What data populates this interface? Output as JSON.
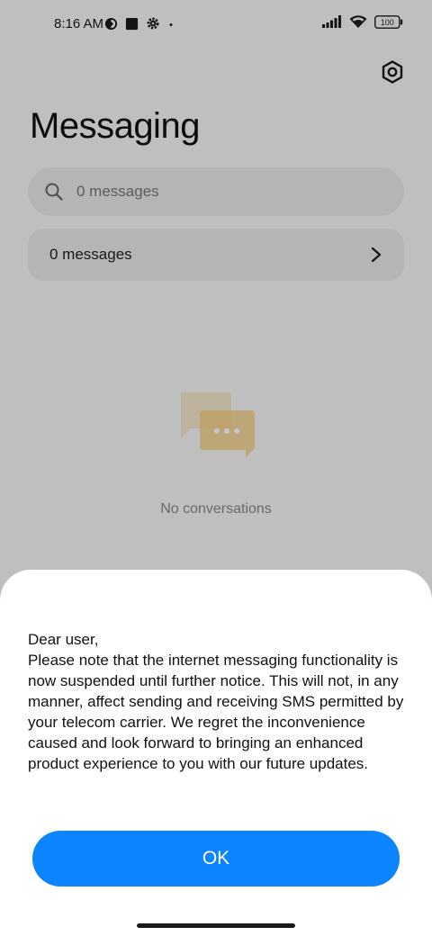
{
  "status_bar": {
    "time": "8:16 AM",
    "battery": "100"
  },
  "header": {
    "title": "Messaging"
  },
  "search": {
    "placeholder": "0 messages"
  },
  "messages_row": {
    "label": "0 messages"
  },
  "empty_state": {
    "text": "No conversations"
  },
  "dialog": {
    "greeting": "Dear user,",
    "body": "Please note that the internet messaging functionality is now suspended until further notice. This will not, in any manner, affect sending and receiving SMS permitted by your telecom carrier. We regret the inconvenience caused and look forward to bringing an enhanced product experience to you with our future updates.",
    "ok_label": "OK"
  },
  "colors": {
    "accent": "#0d84ff",
    "background": "#f5f5f5",
    "empty_icon": "#f2c97a"
  },
  "icons": [
    "contrast-icon",
    "square-icon",
    "gear-icon",
    "dot-icon",
    "signal-icon",
    "wifi-icon",
    "battery-icon",
    "settings-hexagon-icon",
    "search-icon",
    "chevron-right-icon",
    "chat-bubbles-icon"
  ]
}
